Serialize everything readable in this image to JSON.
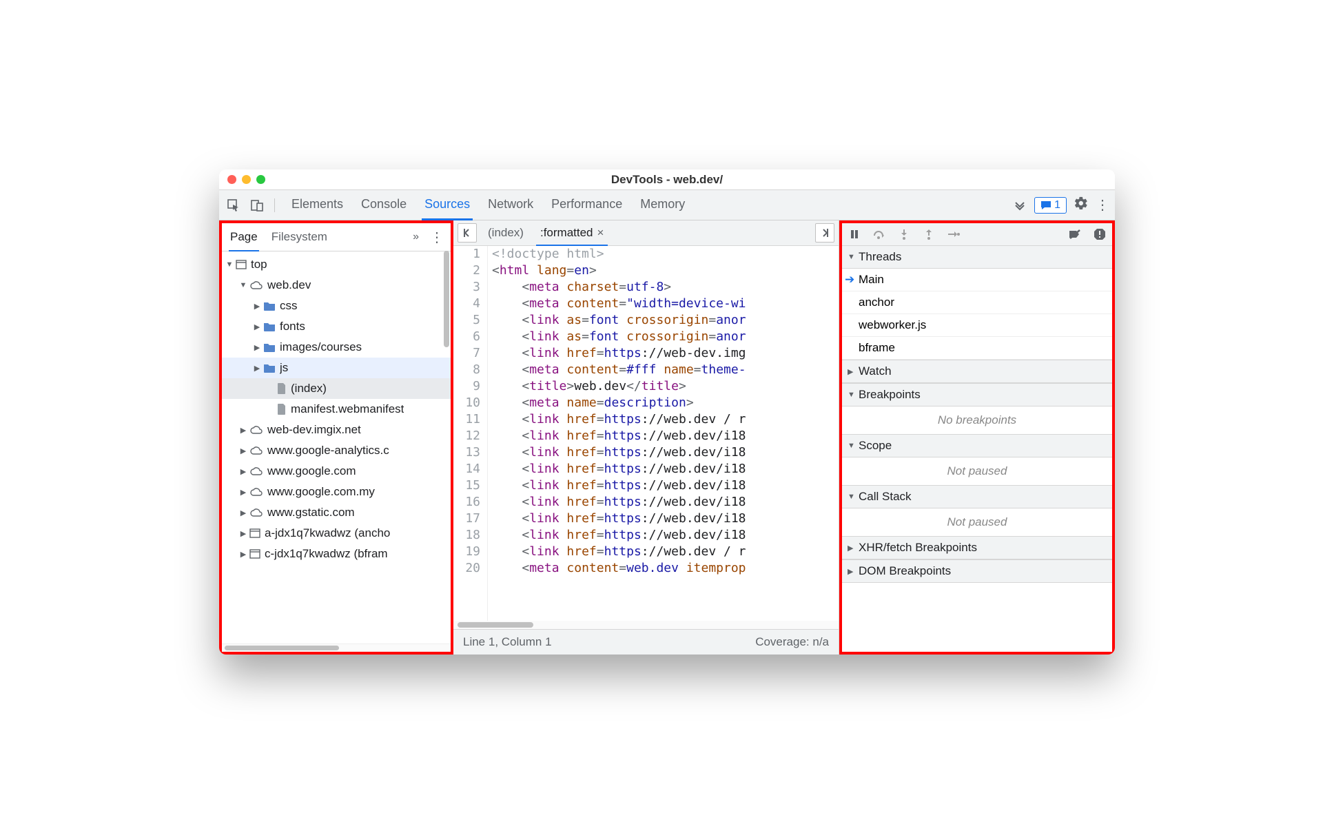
{
  "window": {
    "title": "DevTools - web.dev/"
  },
  "toolbar": {
    "tabs": [
      "Elements",
      "Console",
      "Sources",
      "Network",
      "Performance",
      "Memory"
    ],
    "active_tab": 2,
    "message_count": "1"
  },
  "left": {
    "tabs": [
      "Page",
      "Filesystem"
    ],
    "active_tab": 0,
    "tree": [
      {
        "indent": 0,
        "arrow": "down",
        "icon": "window",
        "label": "top"
      },
      {
        "indent": 1,
        "arrow": "down",
        "icon": "cloud",
        "label": "web.dev"
      },
      {
        "indent": 2,
        "arrow": "right",
        "icon": "folder",
        "label": "css"
      },
      {
        "indent": 2,
        "arrow": "right",
        "icon": "folder",
        "label": "fonts"
      },
      {
        "indent": 2,
        "arrow": "right",
        "icon": "folder",
        "label": "images/courses"
      },
      {
        "indent": 2,
        "arrow": "right",
        "icon": "folder",
        "label": "js",
        "hover": true
      },
      {
        "indent": 3,
        "arrow": "",
        "icon": "file",
        "label": "(index)",
        "selected": true
      },
      {
        "indent": 3,
        "arrow": "",
        "icon": "file",
        "label": "manifest.webmanifest"
      },
      {
        "indent": 1,
        "arrow": "right",
        "icon": "cloud",
        "label": "web-dev.imgix.net"
      },
      {
        "indent": 1,
        "arrow": "right",
        "icon": "cloud",
        "label": "www.google-analytics.c"
      },
      {
        "indent": 1,
        "arrow": "right",
        "icon": "cloud",
        "label": "www.google.com"
      },
      {
        "indent": 1,
        "arrow": "right",
        "icon": "cloud",
        "label": "www.google.com.my"
      },
      {
        "indent": 1,
        "arrow": "right",
        "icon": "cloud",
        "label": "www.gstatic.com"
      },
      {
        "indent": 1,
        "arrow": "right",
        "icon": "window",
        "label": "a-jdx1q7kwadwz (ancho"
      },
      {
        "indent": 1,
        "arrow": "right",
        "icon": "window",
        "label": "c-jdx1q7kwadwz (bfram"
      }
    ]
  },
  "mid": {
    "tabs": [
      {
        "label": "(index)",
        "closable": false
      },
      {
        "label": ":formatted",
        "closable": true
      }
    ],
    "active_tab": 1,
    "code_lines": [
      [
        {
          "c": "doctype",
          "t": "<!doctype html>"
        }
      ],
      [
        {
          "c": "punct",
          "t": "<"
        },
        {
          "c": "tag",
          "t": "html"
        },
        {
          "c": "",
          "t": " "
        },
        {
          "c": "attr",
          "t": "lang"
        },
        {
          "c": "punct",
          "t": "="
        },
        {
          "c": "val",
          "t": "en"
        },
        {
          "c": "punct",
          "t": ">"
        }
      ],
      [
        {
          "c": "",
          "t": "    "
        },
        {
          "c": "punct",
          "t": "<"
        },
        {
          "c": "tag",
          "t": "meta"
        },
        {
          "c": "",
          "t": " "
        },
        {
          "c": "attr",
          "t": "charset"
        },
        {
          "c": "punct",
          "t": "="
        },
        {
          "c": "val",
          "t": "utf-8"
        },
        {
          "c": "punct",
          "t": ">"
        }
      ],
      [
        {
          "c": "",
          "t": "    "
        },
        {
          "c": "punct",
          "t": "<"
        },
        {
          "c": "tag",
          "t": "meta"
        },
        {
          "c": "",
          "t": " "
        },
        {
          "c": "attr",
          "t": "content"
        },
        {
          "c": "punct",
          "t": "="
        },
        {
          "c": "val",
          "t": "\"width=device-wi"
        }
      ],
      [
        {
          "c": "",
          "t": "    "
        },
        {
          "c": "punct",
          "t": "<"
        },
        {
          "c": "tag",
          "t": "link"
        },
        {
          "c": "",
          "t": " "
        },
        {
          "c": "attr",
          "t": "as"
        },
        {
          "c": "punct",
          "t": "="
        },
        {
          "c": "val",
          "t": "font"
        },
        {
          "c": "",
          "t": " "
        },
        {
          "c": "attr",
          "t": "crossorigin"
        },
        {
          "c": "punct",
          "t": "="
        },
        {
          "c": "val",
          "t": "anor"
        }
      ],
      [
        {
          "c": "",
          "t": "    "
        },
        {
          "c": "punct",
          "t": "<"
        },
        {
          "c": "tag",
          "t": "link"
        },
        {
          "c": "",
          "t": " "
        },
        {
          "c": "attr",
          "t": "as"
        },
        {
          "c": "punct",
          "t": "="
        },
        {
          "c": "val",
          "t": "font"
        },
        {
          "c": "",
          "t": " "
        },
        {
          "c": "attr",
          "t": "crossorigin"
        },
        {
          "c": "punct",
          "t": "="
        },
        {
          "c": "val",
          "t": "anor"
        }
      ],
      [
        {
          "c": "",
          "t": "    "
        },
        {
          "c": "punct",
          "t": "<"
        },
        {
          "c": "tag",
          "t": "link"
        },
        {
          "c": "",
          "t": " "
        },
        {
          "c": "attr",
          "t": "href"
        },
        {
          "c": "punct",
          "t": "="
        },
        {
          "c": "val",
          "t": "https"
        },
        {
          "c": "",
          "t": "://web-dev.img"
        }
      ],
      [
        {
          "c": "",
          "t": "    "
        },
        {
          "c": "punct",
          "t": "<"
        },
        {
          "c": "tag",
          "t": "meta"
        },
        {
          "c": "",
          "t": " "
        },
        {
          "c": "attr",
          "t": "content"
        },
        {
          "c": "punct",
          "t": "="
        },
        {
          "c": "val",
          "t": "#fff"
        },
        {
          "c": "",
          "t": " "
        },
        {
          "c": "attr",
          "t": "name"
        },
        {
          "c": "punct",
          "t": "="
        },
        {
          "c": "val",
          "t": "theme-"
        }
      ],
      [
        {
          "c": "",
          "t": "    "
        },
        {
          "c": "punct",
          "t": "<"
        },
        {
          "c": "tag",
          "t": "title"
        },
        {
          "c": "punct",
          "t": ">"
        },
        {
          "c": "",
          "t": "web.dev"
        },
        {
          "c": "punct",
          "t": "</"
        },
        {
          "c": "tag",
          "t": "title"
        },
        {
          "c": "punct",
          "t": ">"
        }
      ],
      [
        {
          "c": "",
          "t": "    "
        },
        {
          "c": "punct",
          "t": "<"
        },
        {
          "c": "tag",
          "t": "meta"
        },
        {
          "c": "",
          "t": " "
        },
        {
          "c": "attr",
          "t": "name"
        },
        {
          "c": "punct",
          "t": "="
        },
        {
          "c": "val",
          "t": "description"
        },
        {
          "c": "punct",
          "t": ">"
        }
      ],
      [
        {
          "c": "",
          "t": "    "
        },
        {
          "c": "punct",
          "t": "<"
        },
        {
          "c": "tag",
          "t": "link"
        },
        {
          "c": "",
          "t": " "
        },
        {
          "c": "attr",
          "t": "href"
        },
        {
          "c": "punct",
          "t": "="
        },
        {
          "c": "val",
          "t": "https"
        },
        {
          "c": "",
          "t": "://web.dev / r"
        }
      ],
      [
        {
          "c": "",
          "t": "    "
        },
        {
          "c": "punct",
          "t": "<"
        },
        {
          "c": "tag",
          "t": "link"
        },
        {
          "c": "",
          "t": " "
        },
        {
          "c": "attr",
          "t": "href"
        },
        {
          "c": "punct",
          "t": "="
        },
        {
          "c": "val",
          "t": "https"
        },
        {
          "c": "",
          "t": "://web.dev/i18"
        }
      ],
      [
        {
          "c": "",
          "t": "    "
        },
        {
          "c": "punct",
          "t": "<"
        },
        {
          "c": "tag",
          "t": "link"
        },
        {
          "c": "",
          "t": " "
        },
        {
          "c": "attr",
          "t": "href"
        },
        {
          "c": "punct",
          "t": "="
        },
        {
          "c": "val",
          "t": "https"
        },
        {
          "c": "",
          "t": "://web.dev/i18"
        }
      ],
      [
        {
          "c": "",
          "t": "    "
        },
        {
          "c": "punct",
          "t": "<"
        },
        {
          "c": "tag",
          "t": "link"
        },
        {
          "c": "",
          "t": " "
        },
        {
          "c": "attr",
          "t": "href"
        },
        {
          "c": "punct",
          "t": "="
        },
        {
          "c": "val",
          "t": "https"
        },
        {
          "c": "",
          "t": "://web.dev/i18"
        }
      ],
      [
        {
          "c": "",
          "t": "    "
        },
        {
          "c": "punct",
          "t": "<"
        },
        {
          "c": "tag",
          "t": "link"
        },
        {
          "c": "",
          "t": " "
        },
        {
          "c": "attr",
          "t": "href"
        },
        {
          "c": "punct",
          "t": "="
        },
        {
          "c": "val",
          "t": "https"
        },
        {
          "c": "",
          "t": "://web.dev/i18"
        }
      ],
      [
        {
          "c": "",
          "t": "    "
        },
        {
          "c": "punct",
          "t": "<"
        },
        {
          "c": "tag",
          "t": "link"
        },
        {
          "c": "",
          "t": " "
        },
        {
          "c": "attr",
          "t": "href"
        },
        {
          "c": "punct",
          "t": "="
        },
        {
          "c": "val",
          "t": "https"
        },
        {
          "c": "",
          "t": "://web.dev/i18"
        }
      ],
      [
        {
          "c": "",
          "t": "    "
        },
        {
          "c": "punct",
          "t": "<"
        },
        {
          "c": "tag",
          "t": "link"
        },
        {
          "c": "",
          "t": " "
        },
        {
          "c": "attr",
          "t": "href"
        },
        {
          "c": "punct",
          "t": "="
        },
        {
          "c": "val",
          "t": "https"
        },
        {
          "c": "",
          "t": "://web.dev/i18"
        }
      ],
      [
        {
          "c": "",
          "t": "    "
        },
        {
          "c": "punct",
          "t": "<"
        },
        {
          "c": "tag",
          "t": "link"
        },
        {
          "c": "",
          "t": " "
        },
        {
          "c": "attr",
          "t": "href"
        },
        {
          "c": "punct",
          "t": "="
        },
        {
          "c": "val",
          "t": "https"
        },
        {
          "c": "",
          "t": "://web.dev/i18"
        }
      ],
      [
        {
          "c": "",
          "t": "    "
        },
        {
          "c": "punct",
          "t": "<"
        },
        {
          "c": "tag",
          "t": "link"
        },
        {
          "c": "",
          "t": " "
        },
        {
          "c": "attr",
          "t": "href"
        },
        {
          "c": "punct",
          "t": "="
        },
        {
          "c": "val",
          "t": "https"
        },
        {
          "c": "",
          "t": "://web.dev / r"
        }
      ],
      [
        {
          "c": "",
          "t": "    "
        },
        {
          "c": "punct",
          "t": "<"
        },
        {
          "c": "tag",
          "t": "meta"
        },
        {
          "c": "",
          "t": " "
        },
        {
          "c": "attr",
          "t": "content"
        },
        {
          "c": "punct",
          "t": "="
        },
        {
          "c": "val",
          "t": "web.dev"
        },
        {
          "c": "",
          "t": " "
        },
        {
          "c": "attr",
          "t": "itemprop"
        }
      ]
    ],
    "status_left": "Line 1, Column 1",
    "status_right": "Coverage: n/a"
  },
  "right": {
    "sections": [
      {
        "title": "Threads",
        "expanded": true,
        "items": [
          {
            "label": "Main",
            "current": true
          },
          {
            "label": "anchor"
          },
          {
            "label": "webworker.js"
          },
          {
            "label": "bframe"
          }
        ]
      },
      {
        "title": "Watch",
        "expanded": false
      },
      {
        "title": "Breakpoints",
        "expanded": true,
        "empty": "No breakpoints"
      },
      {
        "title": "Scope",
        "expanded": true,
        "empty": "Not paused"
      },
      {
        "title": "Call Stack",
        "expanded": true,
        "empty": "Not paused"
      },
      {
        "title": "XHR/fetch Breakpoints",
        "expanded": false
      },
      {
        "title": "DOM Breakpoints",
        "expanded": false
      }
    ]
  }
}
